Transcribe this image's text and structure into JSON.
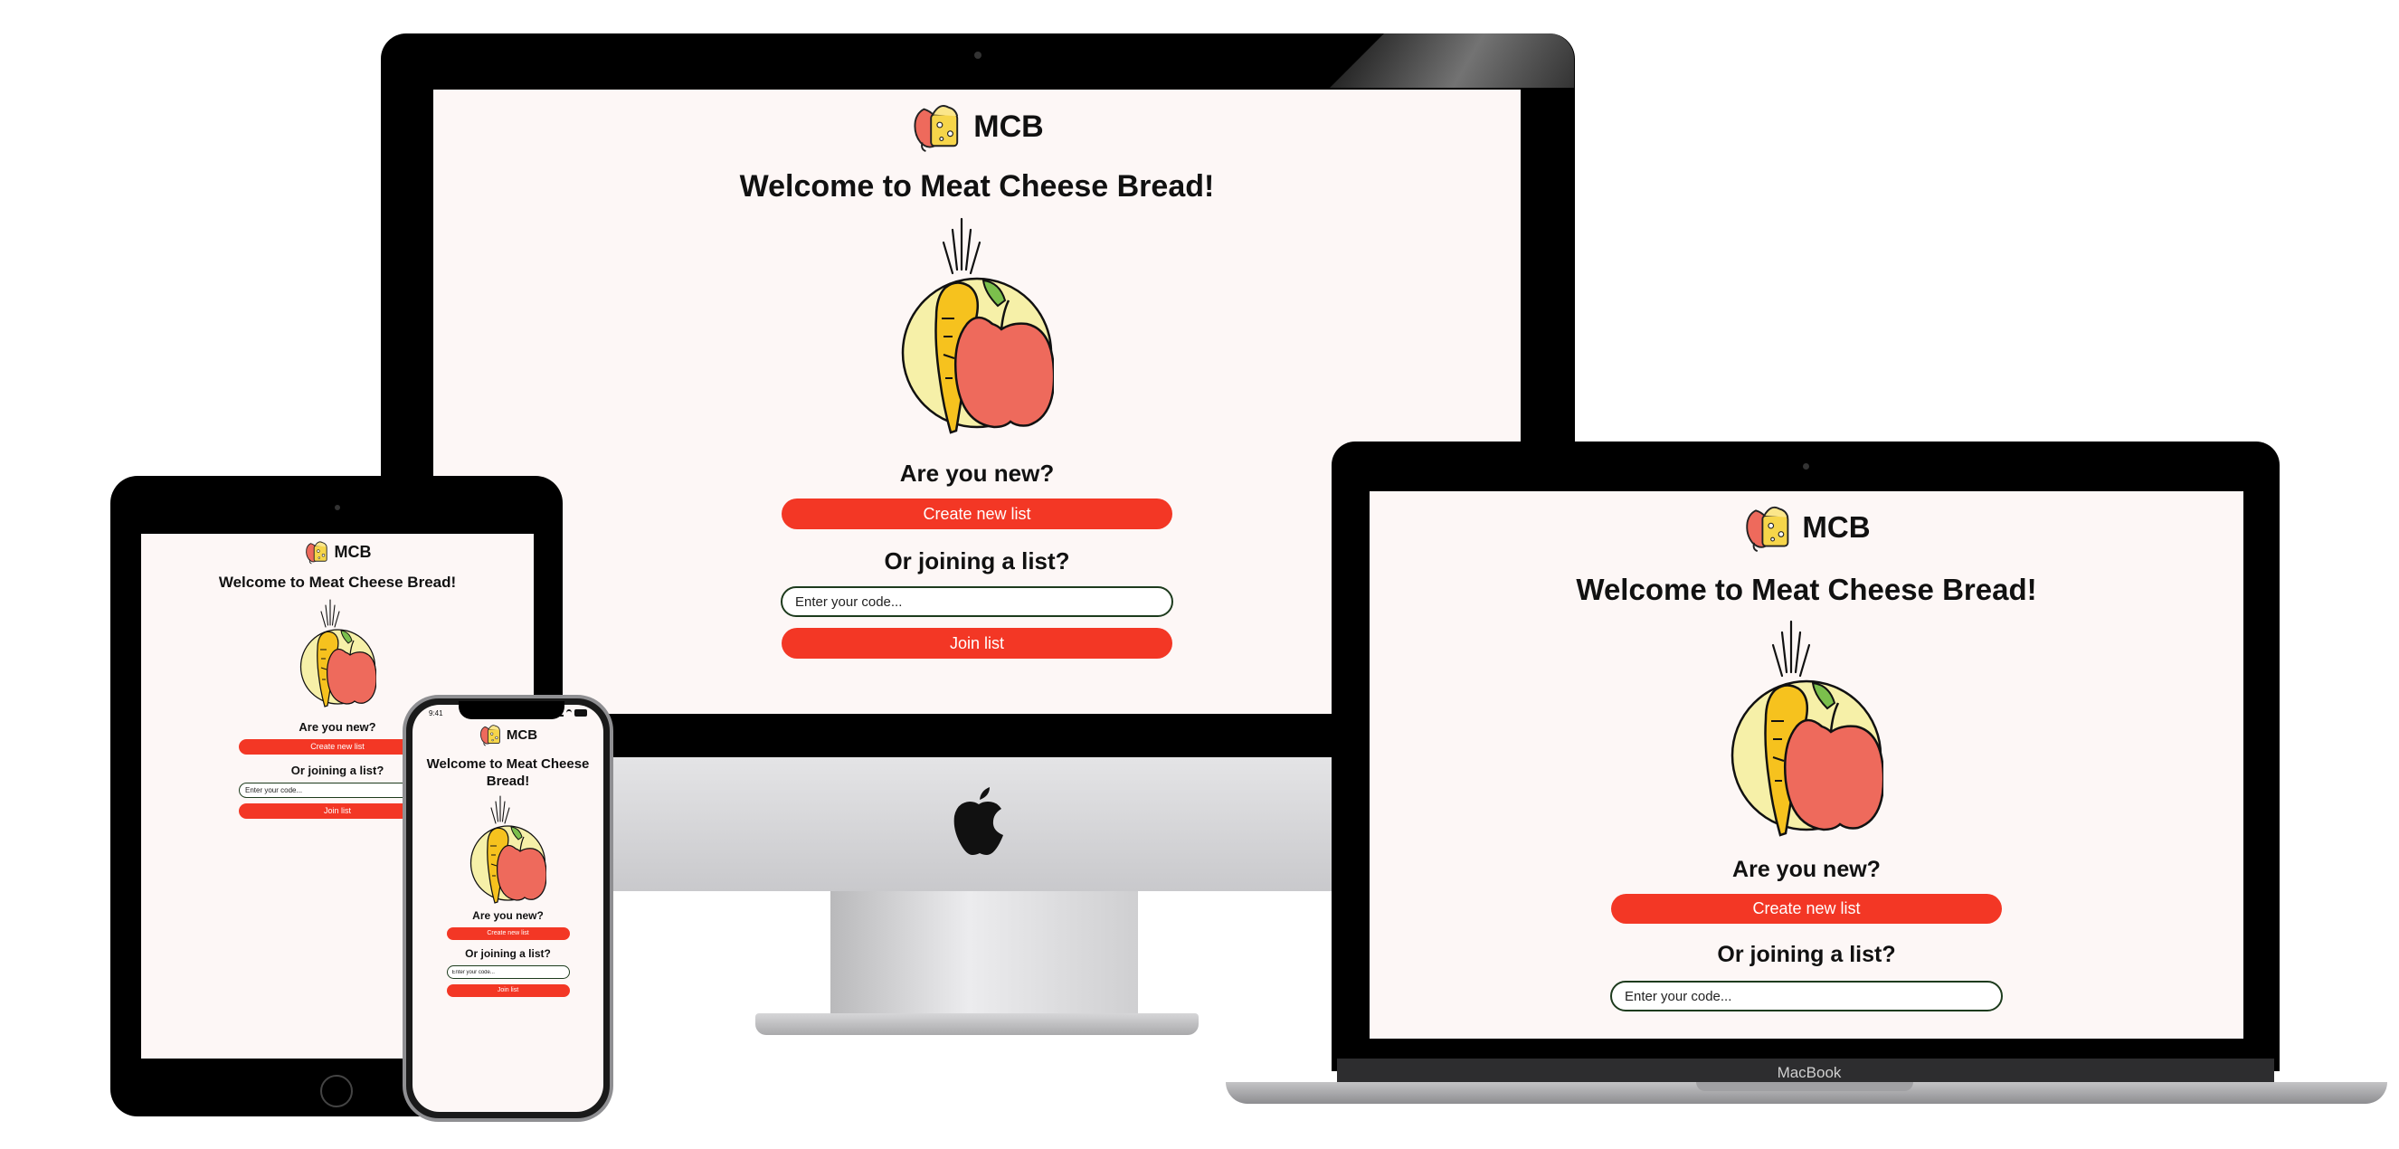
{
  "app": {
    "brand": "MCB",
    "welcome": "Welcome to Meat Cheese Bread!",
    "new_heading": "Are you new?",
    "create_label": "Create new list",
    "join_heading": "Or joining a list?",
    "code_placeholder": "Enter your code...",
    "join_label": "Join list"
  },
  "phone_status": {
    "time": "9:41"
  },
  "laptop_label": "MacBook",
  "colors": {
    "accent": "#f33725",
    "background": "#fdf7f6",
    "carrot": "#f6c21e",
    "apple": "#ee6a5c",
    "circle": "#f6f0a8",
    "leaf": "#7bbf4c"
  },
  "icons": [
    "mcb-logo-icon",
    "carrot-apple-illustration",
    "apple-logo-icon",
    "wifi-icon",
    "battery-icon",
    "signal-icon"
  ]
}
